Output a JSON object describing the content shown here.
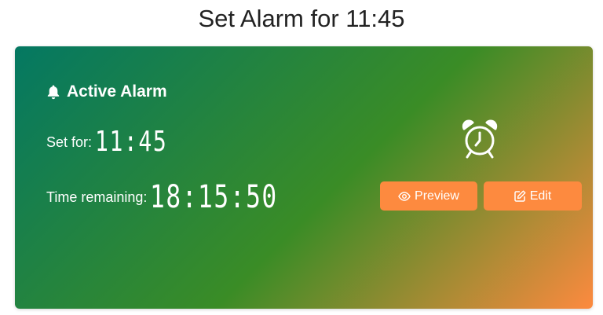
{
  "page": {
    "title": "Set Alarm for 11:45"
  },
  "card": {
    "heading": "Active Alarm",
    "gradient": {
      "start": "#047862",
      "mid": "#3a8c26",
      "end": "#fd8a3f"
    },
    "set_for": {
      "label": "Set for:",
      "value": "11:45"
    },
    "remaining": {
      "label": "Time remaining:",
      "value": "18:15:50"
    },
    "icons": {
      "heading": "bell-icon",
      "status": "alarm-clock-icon"
    },
    "buttons": {
      "preview": {
        "label": "Preview",
        "icon": "eye-icon",
        "color": "#fd8a3f"
      },
      "edit": {
        "label": "Edit",
        "icon": "edit-icon",
        "color": "#fd8a3f"
      }
    }
  }
}
